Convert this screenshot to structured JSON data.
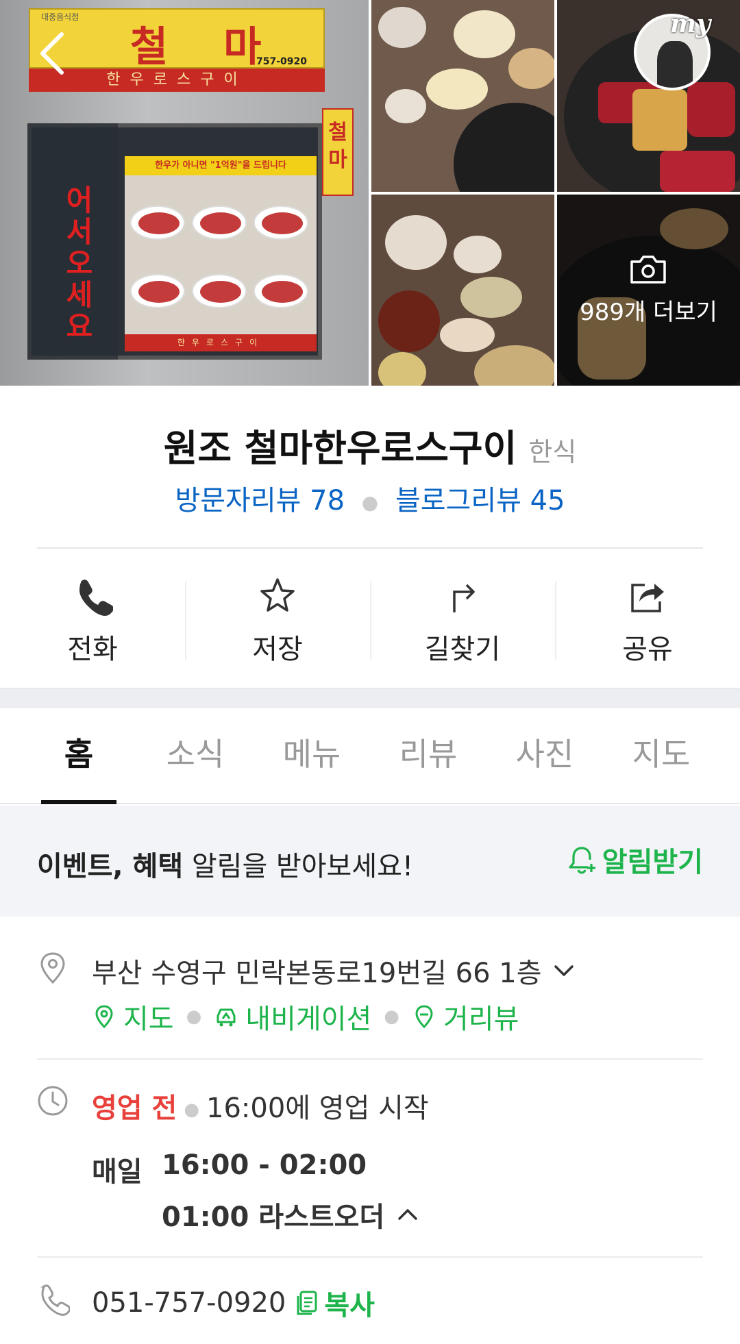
{
  "gallery": {
    "more_label": "989개 더보기",
    "my_badge_label": "my",
    "storefront_sign": {
      "main": "철 마",
      "small": "대중음식점",
      "tel": "757-0920",
      "sub": "한우로스구이",
      "window_banner": "한우가 아니면 \"1억원\"을 드립니다",
      "vertical": "어서오세요",
      "side": "철마"
    }
  },
  "place": {
    "name": "원조 철마한우로스구이",
    "category": "한식",
    "visitor_reviews": "방문자리뷰 78",
    "blog_reviews": "블로그리뷰 45"
  },
  "actions": [
    {
      "label": "전화",
      "icon": "phone-icon"
    },
    {
      "label": "저장",
      "icon": "star-icon"
    },
    {
      "label": "길찾기",
      "icon": "directions-icon"
    },
    {
      "label": "공유",
      "icon": "share-icon"
    }
  ],
  "tabs": [
    {
      "label": "홈",
      "active": true
    },
    {
      "label": "소식",
      "active": false
    },
    {
      "label": "메뉴",
      "active": false
    },
    {
      "label": "리뷰",
      "active": false
    },
    {
      "label": "사진",
      "active": false
    },
    {
      "label": "지도",
      "active": false
    }
  ],
  "banner": {
    "bold_text": "이벤트, 혜택",
    "text": " 알림을 받아보세요!",
    "button_label": "알림받기"
  },
  "address": {
    "text": "부산 수영구 민락본동로19번길 66 1층",
    "links": [
      "지도",
      "내비게이션",
      "거리뷰"
    ]
  },
  "hours": {
    "status": "영업 전",
    "start_text": "16:00에 영업 시작",
    "day": "매일",
    "time": "16:00 - 02:00",
    "last_order": "01:00 라스트오더"
  },
  "phone": {
    "number": "051-757-0920",
    "copy_label": "복사"
  },
  "colors": {
    "link_blue": "#0a64c4",
    "accent_green": "#1db44b",
    "closed_red": "#e8413c"
  }
}
